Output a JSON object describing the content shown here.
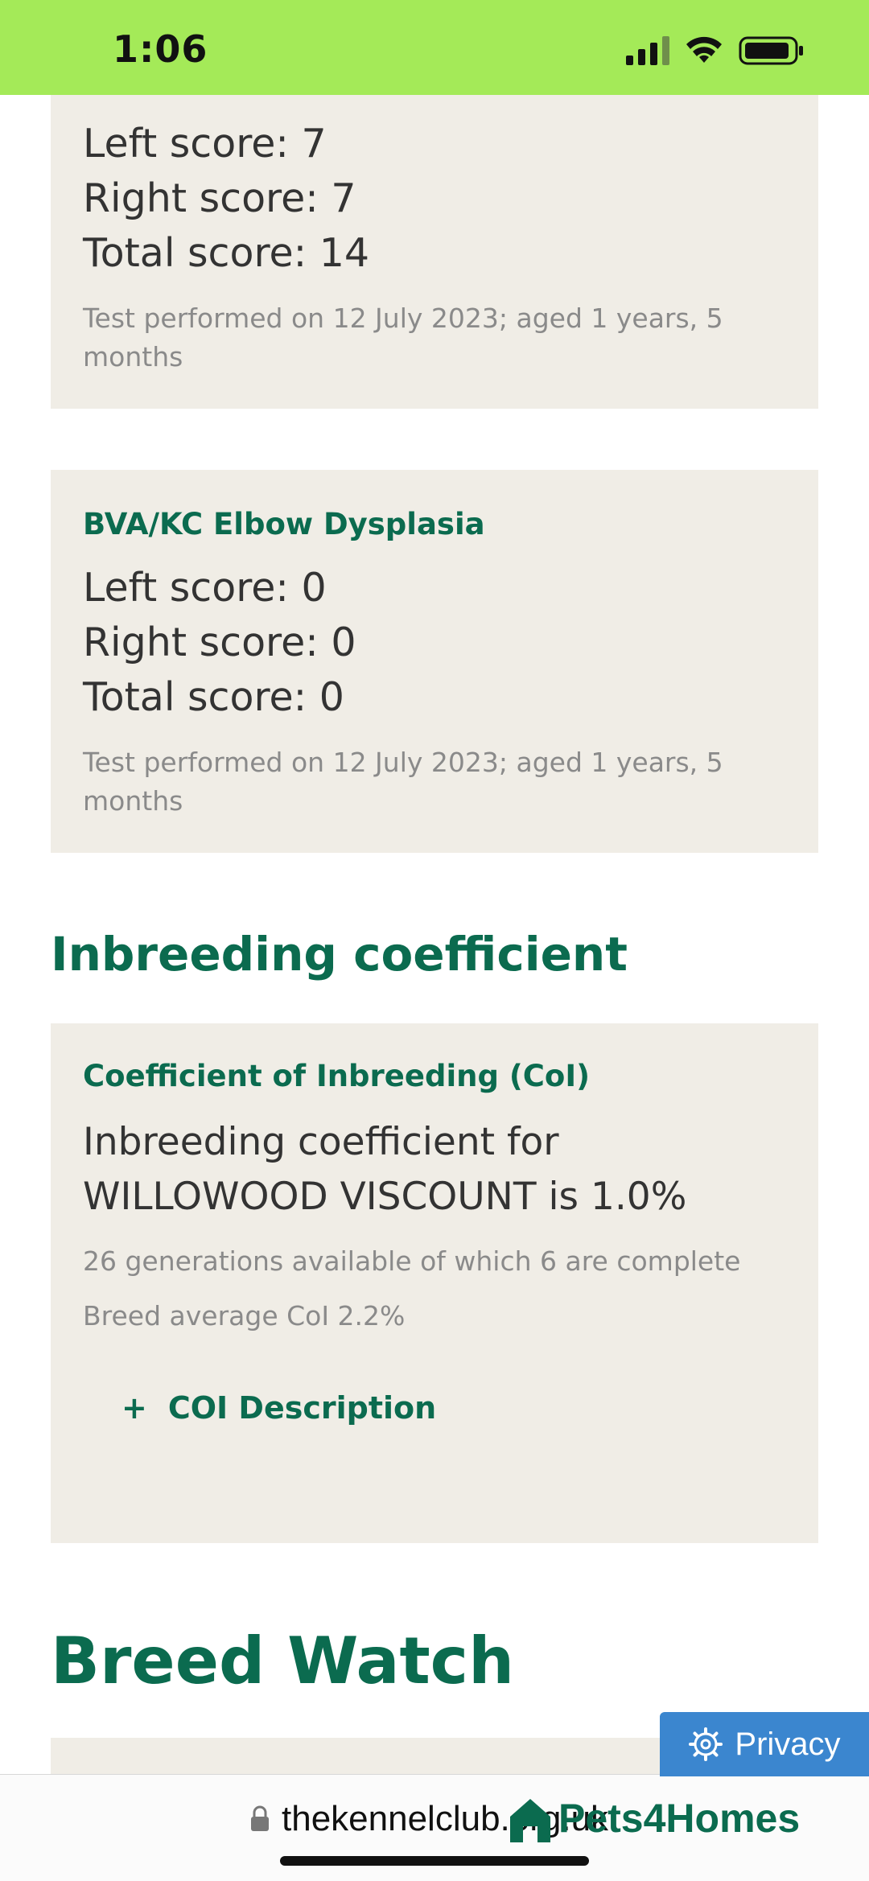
{
  "status": {
    "time": "1:06"
  },
  "hip_card": {
    "left": "Left score: 7",
    "right": "Right score: 7",
    "total": "Total score: 14",
    "meta": "Test performed on 12 July 2023; aged 1 years, 5 months"
  },
  "elbow_card": {
    "title": "BVA/KC Elbow Dysplasia",
    "left": "Left score: 0",
    "right": "Right score: 0",
    "total": "Total score: 0",
    "meta": "Test performed on 12 July 2023; aged 1 years, 5 months"
  },
  "inbreeding": {
    "heading": "Inbreeding coefficient",
    "card_title": "Coefficient of Inbreeding (CoI)",
    "main": "Inbreeding coefficient for WILLOWOOD VISCOUNT is 1.0%",
    "generations": "26 generations available of which 6 are complete",
    "breed_average": "Breed average CoI 2.2%",
    "toggle_symbol": "+",
    "toggle_label": "COI Description"
  },
  "breed_watch": {
    "heading": "Breed Watch"
  },
  "privacy": {
    "label": "Privacy"
  },
  "browser": {
    "url": "thekennelclub.org.uk"
  },
  "overlay_brand": {
    "label": "Pets4Homes"
  },
  "colors": {
    "status_bar": "#a4ea58",
    "accent": "#0b6b4f",
    "card_bg": "#f0ede6",
    "privacy": "#3b86cf"
  }
}
